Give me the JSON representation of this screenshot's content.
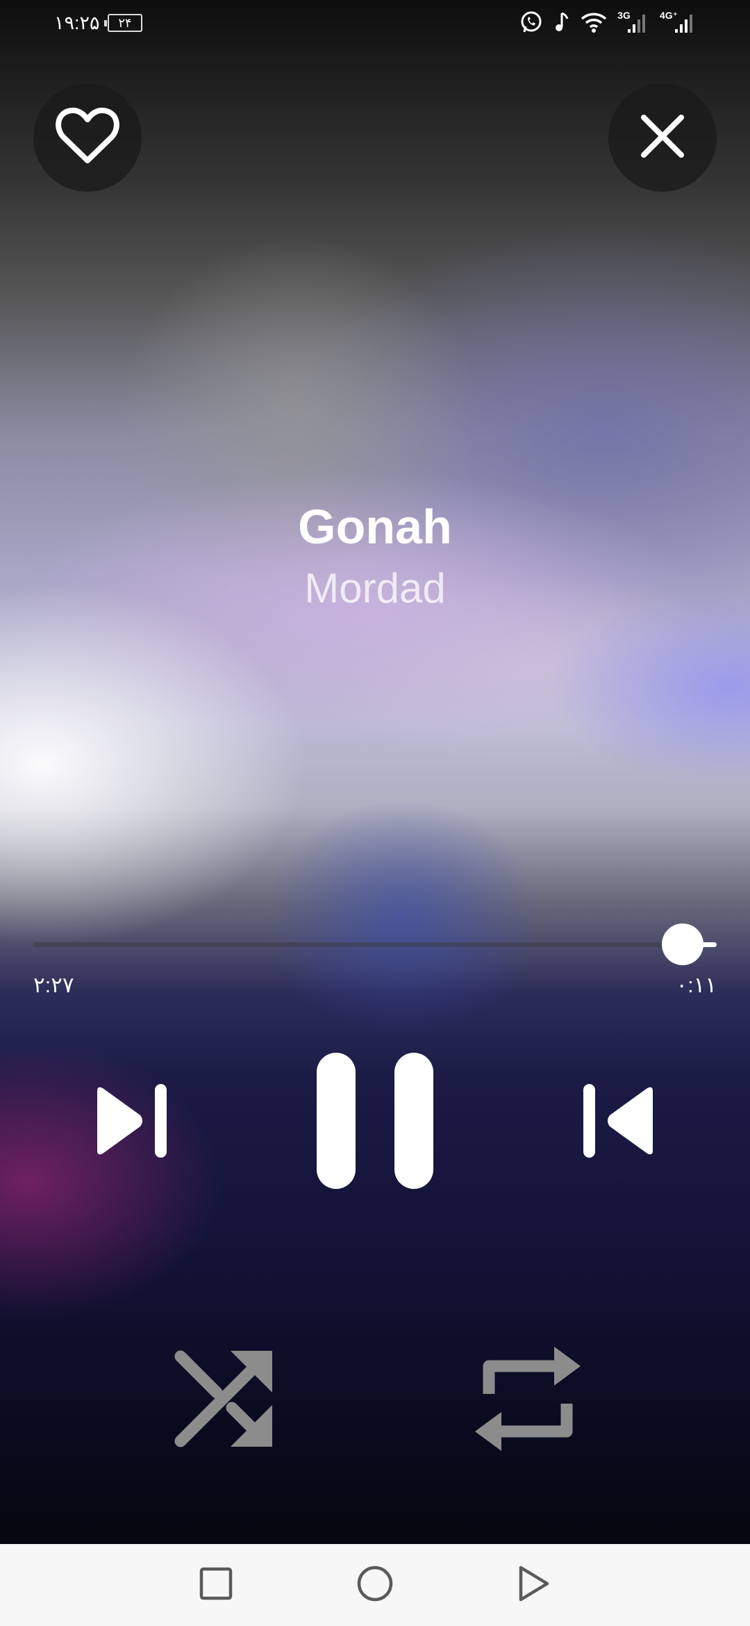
{
  "status_bar": {
    "time": "۱۹:۲۵",
    "battery": "۲۴",
    "icons": [
      "whatsapp-icon",
      "music-note-icon",
      "wifi-icon",
      "signal-3g-icon",
      "signal-4g-icon"
    ],
    "network_labels": [
      "3G",
      "4G⁺"
    ]
  },
  "player": {
    "like_icon": "heart-outline-icon",
    "close_icon": "close-icon",
    "track_title": "Gonah",
    "artist": "Mordad",
    "progress_fraction": 0.05,
    "time_total": "۲:۲۷",
    "time_current": "۰:۱۱",
    "controls": [
      "next-icon",
      "pause-icon",
      "previous-icon",
      "shuffle-icon",
      "repeat-icon"
    ],
    "shuffle_active": false,
    "repeat_active": false
  },
  "nav_bar": {
    "buttons": [
      "recents-icon",
      "home-icon",
      "back-icon"
    ]
  },
  "colors": {
    "control_active": "#ffffff",
    "control_inactive": "#8c8c8c",
    "nav_bar_bg": "#f7f7f7",
    "nav_icon": "#5a5a5a"
  }
}
